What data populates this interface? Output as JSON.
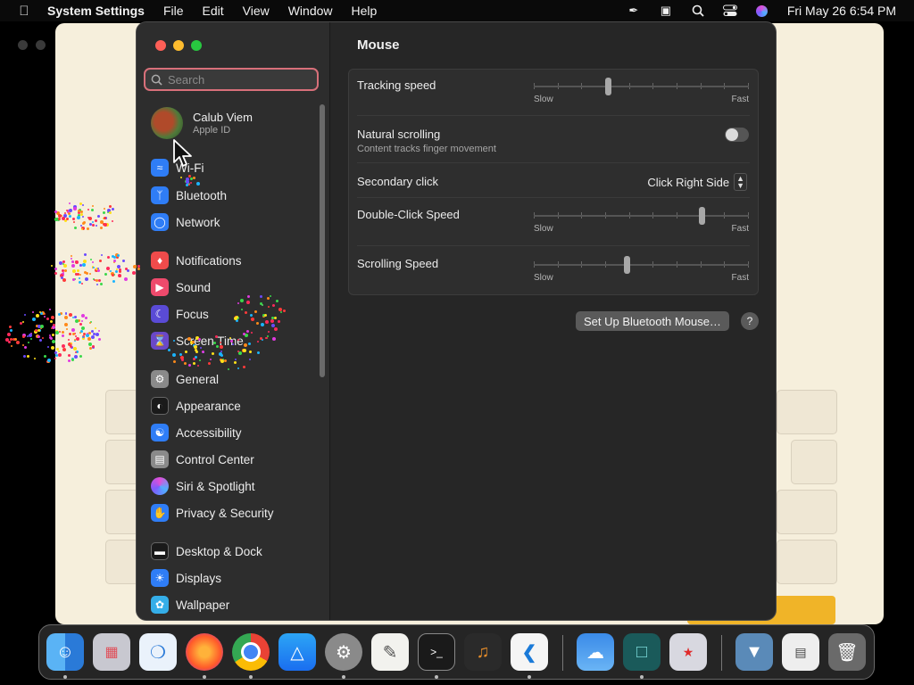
{
  "menubar": {
    "app_name": "System Settings",
    "items": [
      "File",
      "Edit",
      "View",
      "Window",
      "Help"
    ],
    "clock": "Fri May 26  6:54 PM"
  },
  "sidebar": {
    "search_placeholder": "Search",
    "profile": {
      "name": "Calub Viem",
      "subtitle": "Apple ID"
    },
    "items": [
      {
        "label": "Wi-Fi",
        "icon": "wifi-icon",
        "color": "#2f7df6"
      },
      {
        "label": "Bluetooth",
        "icon": "bluetooth-icon",
        "color": "#2f7df6"
      },
      {
        "label": "Network",
        "icon": "globe-icon",
        "color": "#2f7df6"
      },
      {
        "label": "Notifications",
        "icon": "bell-icon",
        "color": "#f04b4b"
      },
      {
        "label": "Sound",
        "icon": "speaker-icon",
        "color": "#ee4a6c"
      },
      {
        "label": "Focus",
        "icon": "moon-icon",
        "color": "#5a4bd6"
      },
      {
        "label": "Screen Time",
        "icon": "hourglass-icon",
        "color": "#6a48c8"
      },
      {
        "label": "General",
        "icon": "gear-icon",
        "color": "#8a8a8a"
      },
      {
        "label": "Appearance",
        "icon": "appearance-icon",
        "color": "#1a1a1a"
      },
      {
        "label": "Accessibility",
        "icon": "accessibility-icon",
        "color": "#2f7df6"
      },
      {
        "label": "Control Center",
        "icon": "control-center-icon",
        "color": "#8a8a8a"
      },
      {
        "label": "Siri & Spotlight",
        "icon": "siri-icon",
        "color": "#b04ad6"
      },
      {
        "label": "Privacy & Security",
        "icon": "hand-icon",
        "color": "#2f7df6"
      },
      {
        "label": "Desktop & Dock",
        "icon": "dock-icon",
        "color": "#1a1a1a"
      },
      {
        "label": "Displays",
        "icon": "sun-icon",
        "color": "#2f7df6"
      },
      {
        "label": "Wallpaper",
        "icon": "wallpaper-icon",
        "color": "#35aee8"
      }
    ]
  },
  "main": {
    "title": "Mouse",
    "tracking_speed": {
      "label": "Tracking speed",
      "min_label": "Slow",
      "max_label": "Fast",
      "value": 0.34
    },
    "natural_scrolling": {
      "label": "Natural scrolling",
      "sublabel": "Content tracks finger movement",
      "enabled": false
    },
    "secondary_click": {
      "label": "Secondary click",
      "value": "Click Right Side"
    },
    "double_click_speed": {
      "label": "Double-Click Speed",
      "min_label": "Slow",
      "max_label": "Fast",
      "value": 0.79
    },
    "scrolling_speed": {
      "label": "Scrolling Speed",
      "min_label": "Slow",
      "max_label": "Fast",
      "value": 0.43
    },
    "bluetooth_button": "Set Up Bluetooth Mouse…",
    "help_label": "?"
  },
  "dock": {
    "apps": [
      "Finder",
      "Launchpad",
      "Safari",
      "Firefox",
      "Chrome",
      "App Store",
      "System Settings",
      "TextEdit",
      "Terminal",
      "GarageBand",
      "VS Code",
      "Weather",
      "Screen Sharing",
      "Input Sources",
      "Downloads",
      "Preview",
      "Trash"
    ]
  }
}
